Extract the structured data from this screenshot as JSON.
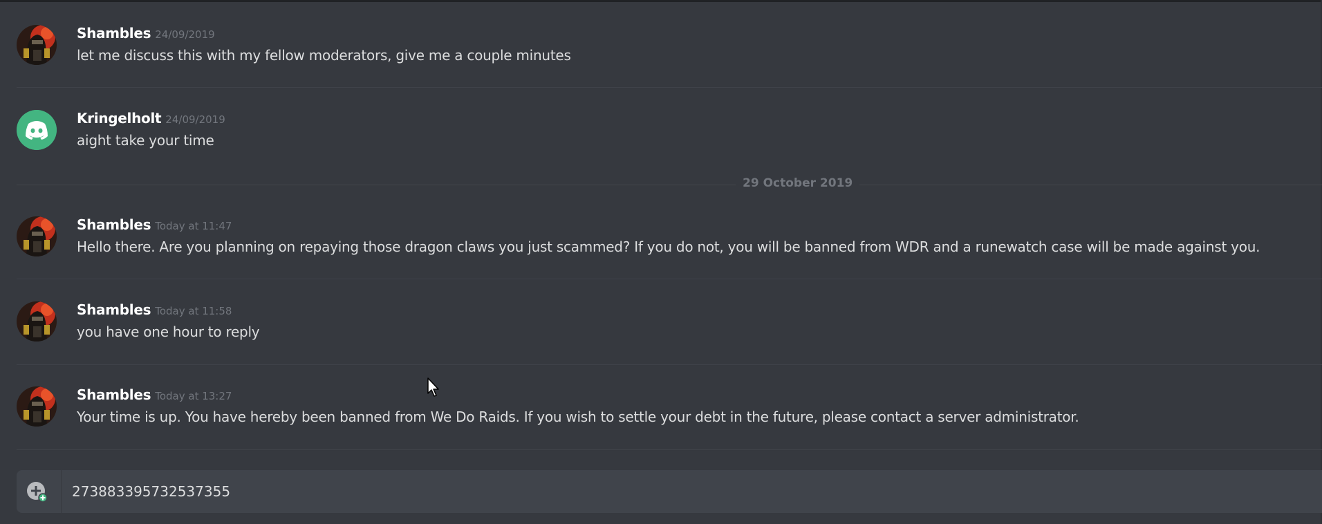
{
  "messages": [
    {
      "author": "Shambles",
      "timestamp": "24/09/2019",
      "text": "let me discuss this with my fellow moderators, give me a couple minutes",
      "avatar": "shambles-avatar"
    },
    {
      "author": "Kringelholt",
      "timestamp": "24/09/2019",
      "text": "aight take your time",
      "avatar": "discord-default-avatar"
    },
    {
      "author": "Shambles",
      "timestamp": "Today at 11:47",
      "text": "Hello there. Are you planning on repaying those dragon claws you just scammed? If you do not, you will be banned from WDR and a runewatch case will be made against you.",
      "avatar": "shambles-avatar"
    },
    {
      "author": "Shambles",
      "timestamp": "Today at 11:58",
      "text": "you have one hour to reply",
      "avatar": "shambles-avatar"
    },
    {
      "author": "Shambles",
      "timestamp": "Today at 13:27",
      "text": "Your time is up. You have hereby been banned from We Do Raids. If you wish to settle your debt in the future, please contact a server administrator.",
      "avatar": "shambles-avatar"
    }
  ],
  "date_divider": "29 October 2019",
  "composer": {
    "value": "273883395732537355",
    "attach_icon": "add-attachment-icon"
  },
  "colors": {
    "background": "#36393f",
    "composer": "#40444b",
    "author": "#ffffff",
    "text": "#dcddde",
    "muted": "#72767d",
    "discord_green": "#43b581"
  }
}
